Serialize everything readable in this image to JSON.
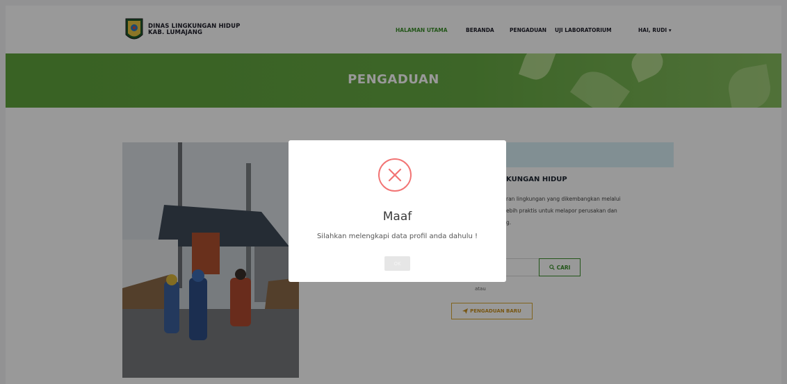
{
  "header": {
    "brand_line1": "DINAS LINGKUNGAN HIDUP",
    "brand_line2": "KAB. LUMAJANG",
    "nav": [
      {
        "label": "HALAMAN UTAMA",
        "active": true
      },
      {
        "label": "BERANDA",
        "active": false
      },
      {
        "label": "PENGADUAN",
        "active": false
      },
      {
        "label": "UJI LABORATORIUM",
        "active": false
      },
      {
        "label": "HAI, RUDI",
        "active": false
      }
    ]
  },
  "banner": {
    "title": "PENGADUAN"
  },
  "content": {
    "heading": "KUNGAN HIDUP",
    "description_line1": "ran lingkungan yang dikembangkan melalui",
    "description_line2": "ebih praktis untuk melapor perusakan dan",
    "description_line3": "g.",
    "search_button_label": "CARI",
    "or_text": "atau",
    "new_complaint_label": "PENGADUAN BARU"
  },
  "modal": {
    "title": "Maaf",
    "message": "Silahkan melengkapi data profil anda dahulu !",
    "ok_label": "OK"
  },
  "colors": {
    "accent_green": "#3b8f2b",
    "banner_green": "#66a943",
    "error_red": "#f27474",
    "secondary_gold": "#d8a62f"
  },
  "icons": {
    "logo": "regency-shield-logo",
    "dropdown": "caret-down-icon",
    "search": "search-icon",
    "send": "paper-plane-icon",
    "error": "x-circle-icon"
  }
}
